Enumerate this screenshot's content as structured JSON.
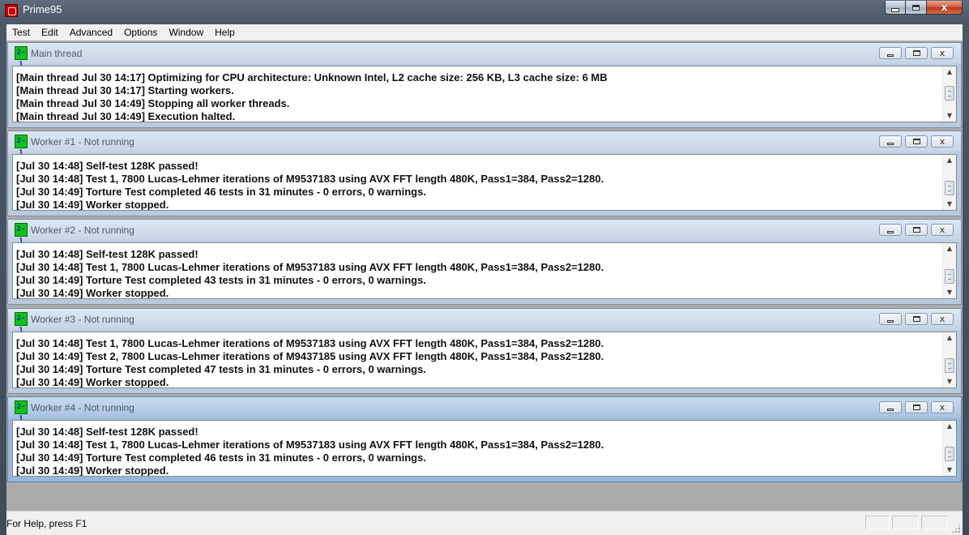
{
  "window": {
    "title": "Prime95",
    "minimize": "",
    "maximize": "",
    "close": "x"
  },
  "menu": [
    "Test",
    "Edit",
    "Advanced",
    "Options",
    "Window",
    "Help"
  ],
  "child_icon_text": "2-1",
  "children": [
    {
      "title": "Main thread",
      "partial_line": "",
      "lines": [
        "[Main thread Jul 30 14:17] Optimizing for CPU architecture: Unknown Intel, L2 cache size: 256 KB, L3 cache size: 6 MB",
        "[Main thread Jul 30 14:17] Starting workers.",
        "[Main thread Jul 30 14:49] Stopping all worker threads.",
        "[Main thread Jul 30 14:49] Execution halted."
      ]
    },
    {
      "title": "Worker #1 - Not running",
      "partial_line": "",
      "lines": [
        "[Jul 30 14:48] Self-test 128K passed!",
        "[Jul 30 14:48] Test 1, 7800 Lucas-Lehmer iterations of M9537183 using AVX FFT length 480K, Pass1=384, Pass2=1280.",
        "[Jul 30 14:49] Torture Test completed 46 tests in 31 minutes - 0 errors, 0 warnings.",
        "[Jul 30 14:49] Worker stopped."
      ]
    },
    {
      "title": "Worker #2 - Not running",
      "partial_line": "",
      "lines": [
        "[Jul 30 14:48] Self-test 128K passed!",
        "[Jul 30 14:48] Test 1, 7800 Lucas-Lehmer iterations of M9537183 using AVX FFT length 480K, Pass1=384, Pass2=1280.",
        "[Jul 30 14:49] Torture Test completed 43 tests in 31 minutes - 0 errors, 0 warnings.",
        "[Jul 30 14:49] Worker stopped."
      ]
    },
    {
      "title": "Worker #3 - Not running",
      "partial_line": "",
      "lines": [
        "[Jul 30 14:48] Test 1, 7800 Lucas-Lehmer iterations of M9537183 using AVX FFT length 480K, Pass1=384, Pass2=1280.",
        "[Jul 30 14:49] Test 2, 7800 Lucas-Lehmer iterations of M9437185 using AVX FFT length 480K, Pass1=384, Pass2=1280.",
        "[Jul 30 14:49] Torture Test completed 47 tests in 31 minutes - 0 errors, 0 warnings.",
        "[Jul 30 14:49] Worker stopped."
      ]
    },
    {
      "title": "Worker #4 - Not running",
      "partial_line": "",
      "lines": [
        "[Jul 30 14:48] Self-test 128K passed!",
        "[Jul 30 14:48] Test 1, 7800 Lucas-Lehmer iterations of M9537183 using AVX FFT length 480K, Pass1=384, Pass2=1280.",
        "[Jul 30 14:49] Torture Test completed 46 tests in 31 minutes - 0 errors, 0 warnings.",
        "[Jul 30 14:49] Worker stopped."
      ]
    }
  ],
  "active_child_index": 4,
  "status": {
    "text": "For Help, press F1"
  },
  "colors": {
    "app_icon": "#c40000",
    "child_icon": "#11c21a",
    "mdi_background": "#ababab"
  }
}
